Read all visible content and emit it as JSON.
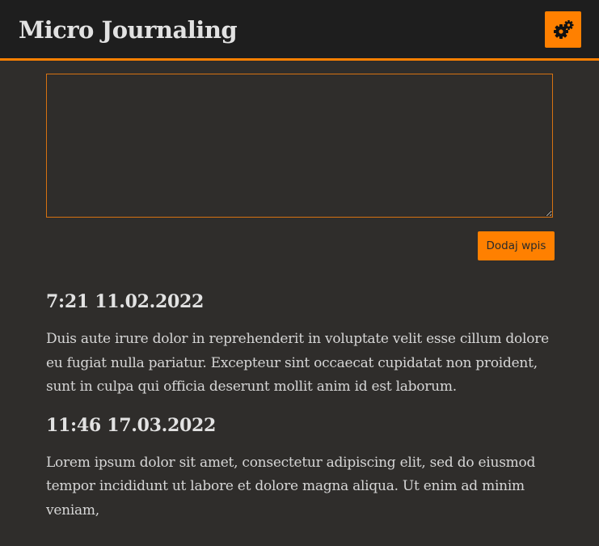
{
  "header": {
    "title": "Micro Journaling",
    "settings_icon": "gears-icon"
  },
  "composer": {
    "value": "",
    "placeholder": "",
    "add_label": "Dodaj wpis"
  },
  "entries": [
    {
      "date": "7:21 11.02.2022",
      "text": "Duis aute irure dolor in reprehenderit in voluptate velit esse cillum dolore eu fugiat nulla pariatur. Excepteur sint occaecat cupidatat non proident, sunt in culpa qui officia deserunt mollit anim id est laborum."
    },
    {
      "date": "11:46 17.03.2022",
      "text": "Lorem ipsum dolor sit amet, consectetur adipiscing elit, sed do eiusmod tempor incididunt ut labore et dolore magna aliqua. Ut enim ad minim veniam,"
    }
  ],
  "colors": {
    "accent": "#ff8000",
    "header_bg": "#1e1e1e",
    "page_bg": "#2f2d2b",
    "text": "#e2e2e2"
  }
}
